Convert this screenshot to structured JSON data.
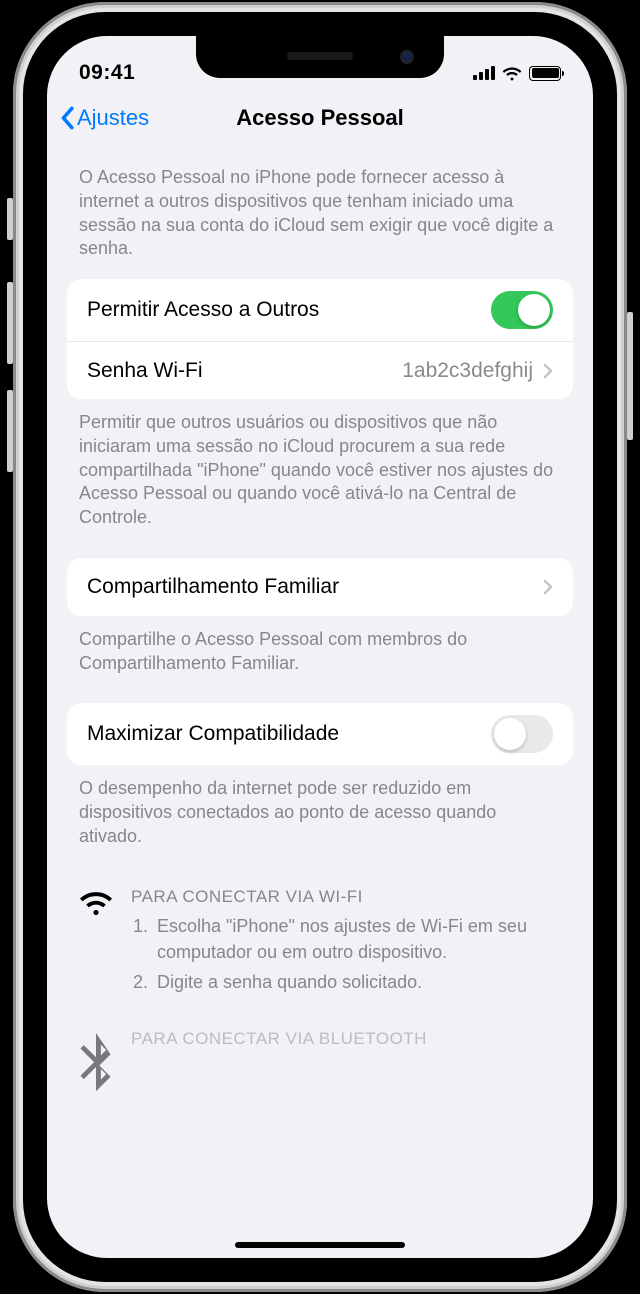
{
  "status": {
    "time": "09:41"
  },
  "nav": {
    "back": "Ajustes",
    "title": "Acesso Pessoal"
  },
  "intro": "O Acesso Pessoal no iPhone pode fornecer acesso à internet a outros dispositivos que tenham iniciado uma sessão na sua conta do iCloud sem exigir que você digite a senha.",
  "group1": {
    "allow_label": "Permitir Acesso a Outros",
    "wifi_label": "Senha Wi-Fi",
    "wifi_value": "1ab2c3defghij"
  },
  "group1_footer": "Permitir que outros usuários ou dispositivos que não iniciaram uma sessão no iCloud procurem a sua rede compartilhada \"iPhone\" quando você estiver nos ajustes do Acesso Pessoal ou quando você ativá-lo na Central de Controle.",
  "group2": {
    "family_label": "Compartilhamento Familiar"
  },
  "group2_footer": "Compartilhe o Acesso Pessoal com membros do Compartilhamento Familiar.",
  "group3": {
    "max_label": "Maximizar Compatibilidade"
  },
  "group3_footer": "O desempenho da internet pode ser reduzido em dispositivos conectados ao ponto de acesso quando ativado.",
  "instr_wifi": {
    "header": "PARA CONECTAR VIA WI-FI",
    "step1": "Escolha \"iPhone\" nos ajustes de Wi-Fi em seu computador ou em outro dispositivo.",
    "step2": "Digite a senha quando solicitado."
  },
  "instr_bt": {
    "header": "PARA CONECTAR VIA BLUETOOTH"
  }
}
